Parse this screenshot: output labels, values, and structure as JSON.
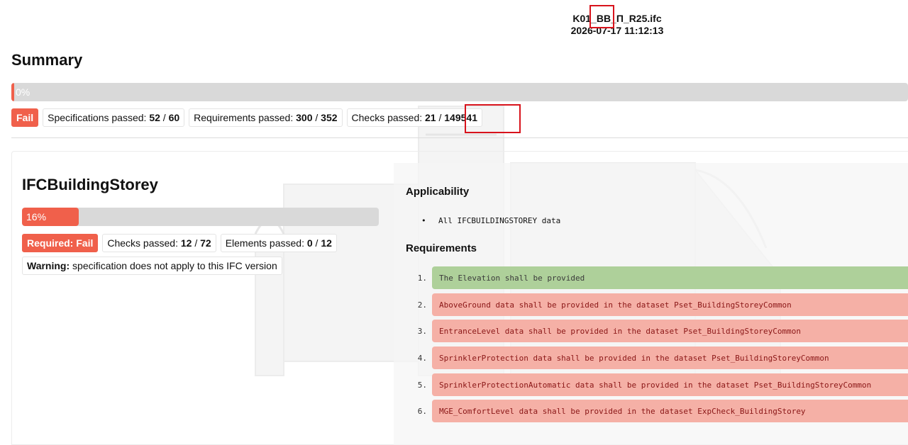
{
  "report": {
    "file_name": "K01_BB_П_R25.ifc",
    "date": "2026-07-17 11:12:13"
  },
  "summary": {
    "title": "Summary",
    "progress": {
      "percent": 0,
      "label": "0%"
    },
    "status": "Fail",
    "specifications": {
      "label": "Specifications passed:",
      "passed": "52",
      "total": "60"
    },
    "requirements": {
      "label": "Requirements passed:",
      "passed": "300",
      "total": "352"
    },
    "checks": {
      "label": "Checks passed:",
      "passed": "21",
      "total": "149541"
    }
  },
  "specification": {
    "title": "IFCBuildingStorey",
    "progress": {
      "percent": 16,
      "label": "16%"
    },
    "required_status": "Required: Fail",
    "checks": {
      "label": "Checks passed:",
      "passed": "12",
      "total": "72"
    },
    "elements": {
      "label": "Elements passed:",
      "passed": "0",
      "total": "12"
    },
    "warning": {
      "label": "Warning:",
      "text": "specification does not apply to this IFC version"
    },
    "applicability": {
      "heading": "Applicability",
      "items": [
        "All IFCBUILDINGSTOREY data"
      ]
    },
    "requirements_list": {
      "heading": "Requirements",
      "items": [
        {
          "num": "1.",
          "text": "The Elevation shall be provided",
          "status": "pass"
        },
        {
          "num": "2.",
          "text": "AboveGround data shall be provided in the dataset Pset_BuildingStoreyCommon",
          "status": "fail"
        },
        {
          "num": "3.",
          "text": "EntranceLevel data shall be provided in the dataset Pset_BuildingStoreyCommon",
          "status": "fail"
        },
        {
          "num": "4.",
          "text": "SprinklerProtection data shall be provided in the dataset Pset_BuildingStoreyCommon",
          "status": "fail"
        },
        {
          "num": "5.",
          "text": "SprinklerProtectionAutomatic data shall be provided in the dataset Pset_BuildingStoreyCommon",
          "status": "fail"
        },
        {
          "num": "6.",
          "text": "MGE_ComfortLevel data shall be provided in the dataset ExpCheck_BuildingStorey",
          "status": "fail"
        }
      ]
    }
  },
  "colors": {
    "fail": "#f0604b",
    "pass_row": "#aed09a",
    "fail_row": "#f5b0a6",
    "highlight": "#d8131c"
  }
}
